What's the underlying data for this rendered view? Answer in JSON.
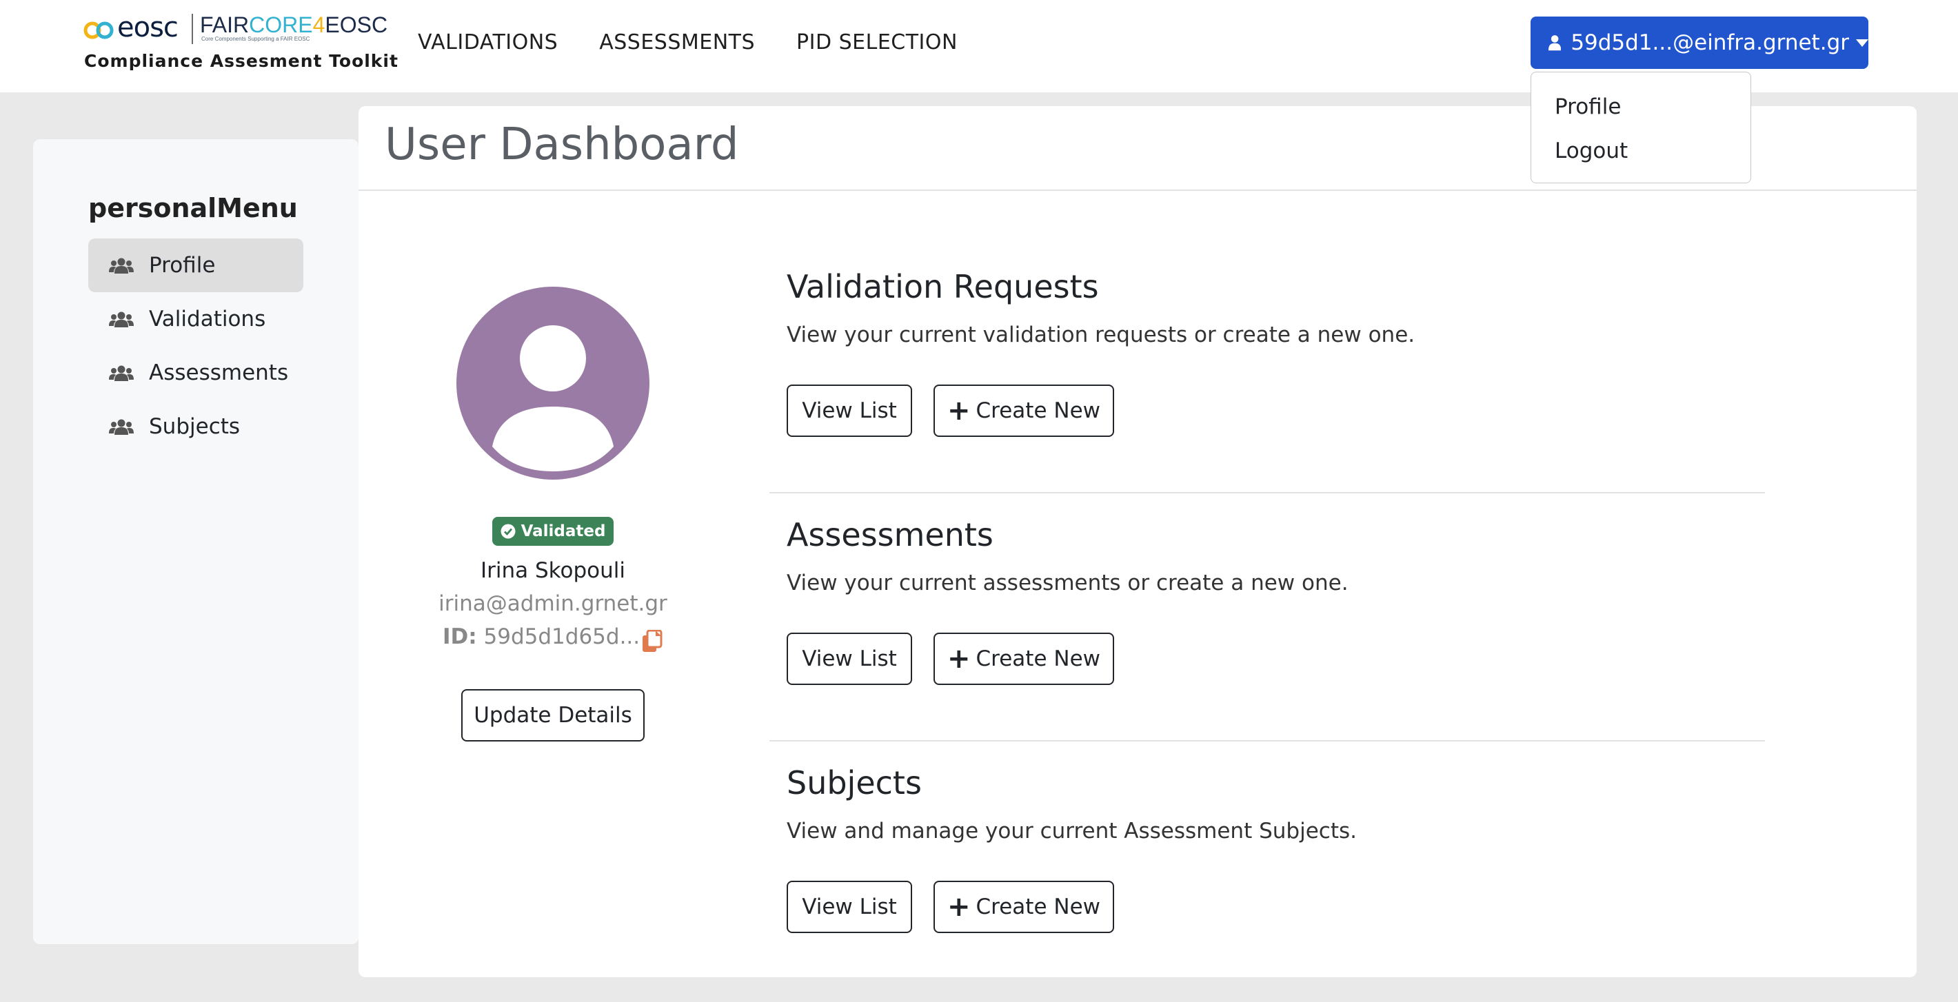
{
  "brand": {
    "eosc": "eosc",
    "fair_part1": "FAIR",
    "fair_part2": "CORE",
    "fair_part3": "4",
    "fair_part4": "EOSC",
    "fair_subtitle": "Core Components Supporting a FAIR EOSC",
    "toolkit": "Compliance Assesment Toolkit"
  },
  "topnav": [
    "VALIDATIONS",
    "ASSESSMENTS",
    "PID SELECTION"
  ],
  "user_menu": {
    "label": "59d5d1...@einfra.grnet.gr",
    "items": [
      "Profile",
      "Logout"
    ]
  },
  "sidebar": {
    "title": "personalMenu",
    "items": [
      {
        "label": "Profile",
        "icon": "users-icon",
        "active": true
      },
      {
        "label": "Validations",
        "icon": "users-icon",
        "active": false
      },
      {
        "label": "Assessments",
        "icon": "users-icon",
        "active": false
      },
      {
        "label": "Subjects",
        "icon": "users-icon",
        "active": false
      }
    ]
  },
  "main": {
    "title": "User Dashboard",
    "profile": {
      "badge": "Validated",
      "name": "Irina Skopouli",
      "email": "irina@admin.grnet.gr",
      "id_label": "ID:",
      "id_value": "59d5d1d65d...",
      "update_button": "Update Details"
    },
    "sections": [
      {
        "title": "Validation Requests",
        "description": "View your current validation requests or create a new one.",
        "view_label": "View List",
        "create_label": "Create New"
      },
      {
        "title": "Assessments",
        "description": "View your current assessments or create a new one.",
        "view_label": "View List",
        "create_label": "Create New"
      },
      {
        "title": "Subjects",
        "description": "View and manage your current Assessment Subjects.",
        "view_label": "View List",
        "create_label": "Create New"
      }
    ]
  },
  "colors": {
    "primary": "#2155cd",
    "validated_badge": "#3d8358",
    "avatar": "#9a7ba6",
    "copy_icon": "#e07b4f"
  }
}
